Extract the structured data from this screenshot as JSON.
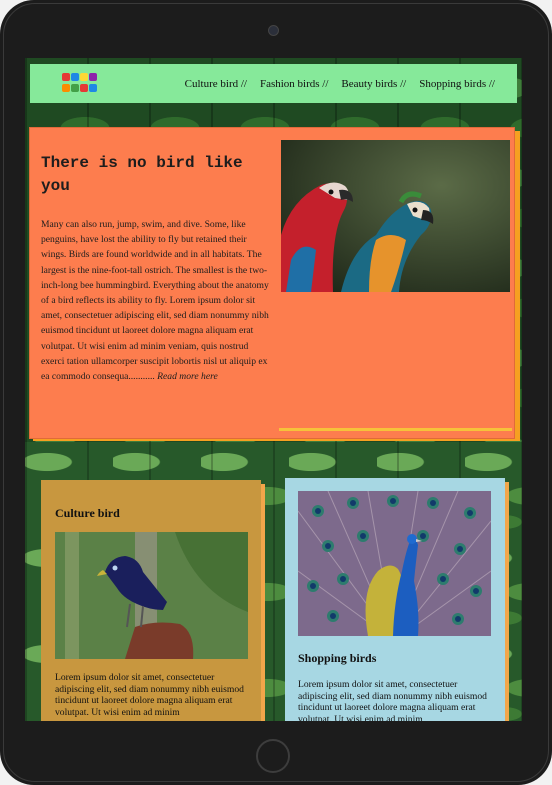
{
  "nav": {
    "items": [
      {
        "label": "Culture bird //"
      },
      {
        "label": "Fashion birds //"
      },
      {
        "label": "Beauty birds //"
      },
      {
        "label": "Shopping birds //"
      }
    ]
  },
  "hero": {
    "title": "There is no bird like you",
    "body": "Many can also run, jump, swim, and dive. Some, like penguins, have lost the ability to fly but retained their wings. Birds are found worldwide and in all habitats. The largest is the nine-foot-tall ostrich. The smallest is the two-inch-long bee hummingbird. Everything about the anatomy of a bird reflects its ability to fly. Lorem ipsum dolor sit amet, consectetuer adipiscing elit, sed diam nonummy nibh euismod tincidunt ut laoreet dolore magna aliquam erat volutpat. Ut wisi enim ad minim veniam, quis nostrud exerci tation ullamcorper suscipit lobortis nisl ut aliquip ex ea commodo consequa...........",
    "read_more": "Read more here"
  },
  "cards": {
    "culture": {
      "title": "Culture bird",
      "text": "Lorem ipsum dolor sit amet, consectetuer adipiscing elit, sed diam nonummy nibh euismod tincidunt ut laoreet dolore magna aliquam erat volutpat. Ut wisi enim ad minim"
    },
    "shopping": {
      "title": "Shopping birds",
      "text": "Lorem ipsum dolor sit amet, consectetuer adipiscing elit, sed diam nonummy nibh euismod tincidunt ut laoreet dolore magna aliquam erat volutpat. Ut wisi enim ad minim"
    }
  },
  "colors": {
    "nav_bg": "#86e99a",
    "hero_bg": "#fd7d4e",
    "culture_card_bg": "#c8973f",
    "shopping_card_bg": "#a7d7e3",
    "card_shadow": "#f2a64a"
  },
  "icons": {
    "logo": "tutti-frutti-logo"
  }
}
